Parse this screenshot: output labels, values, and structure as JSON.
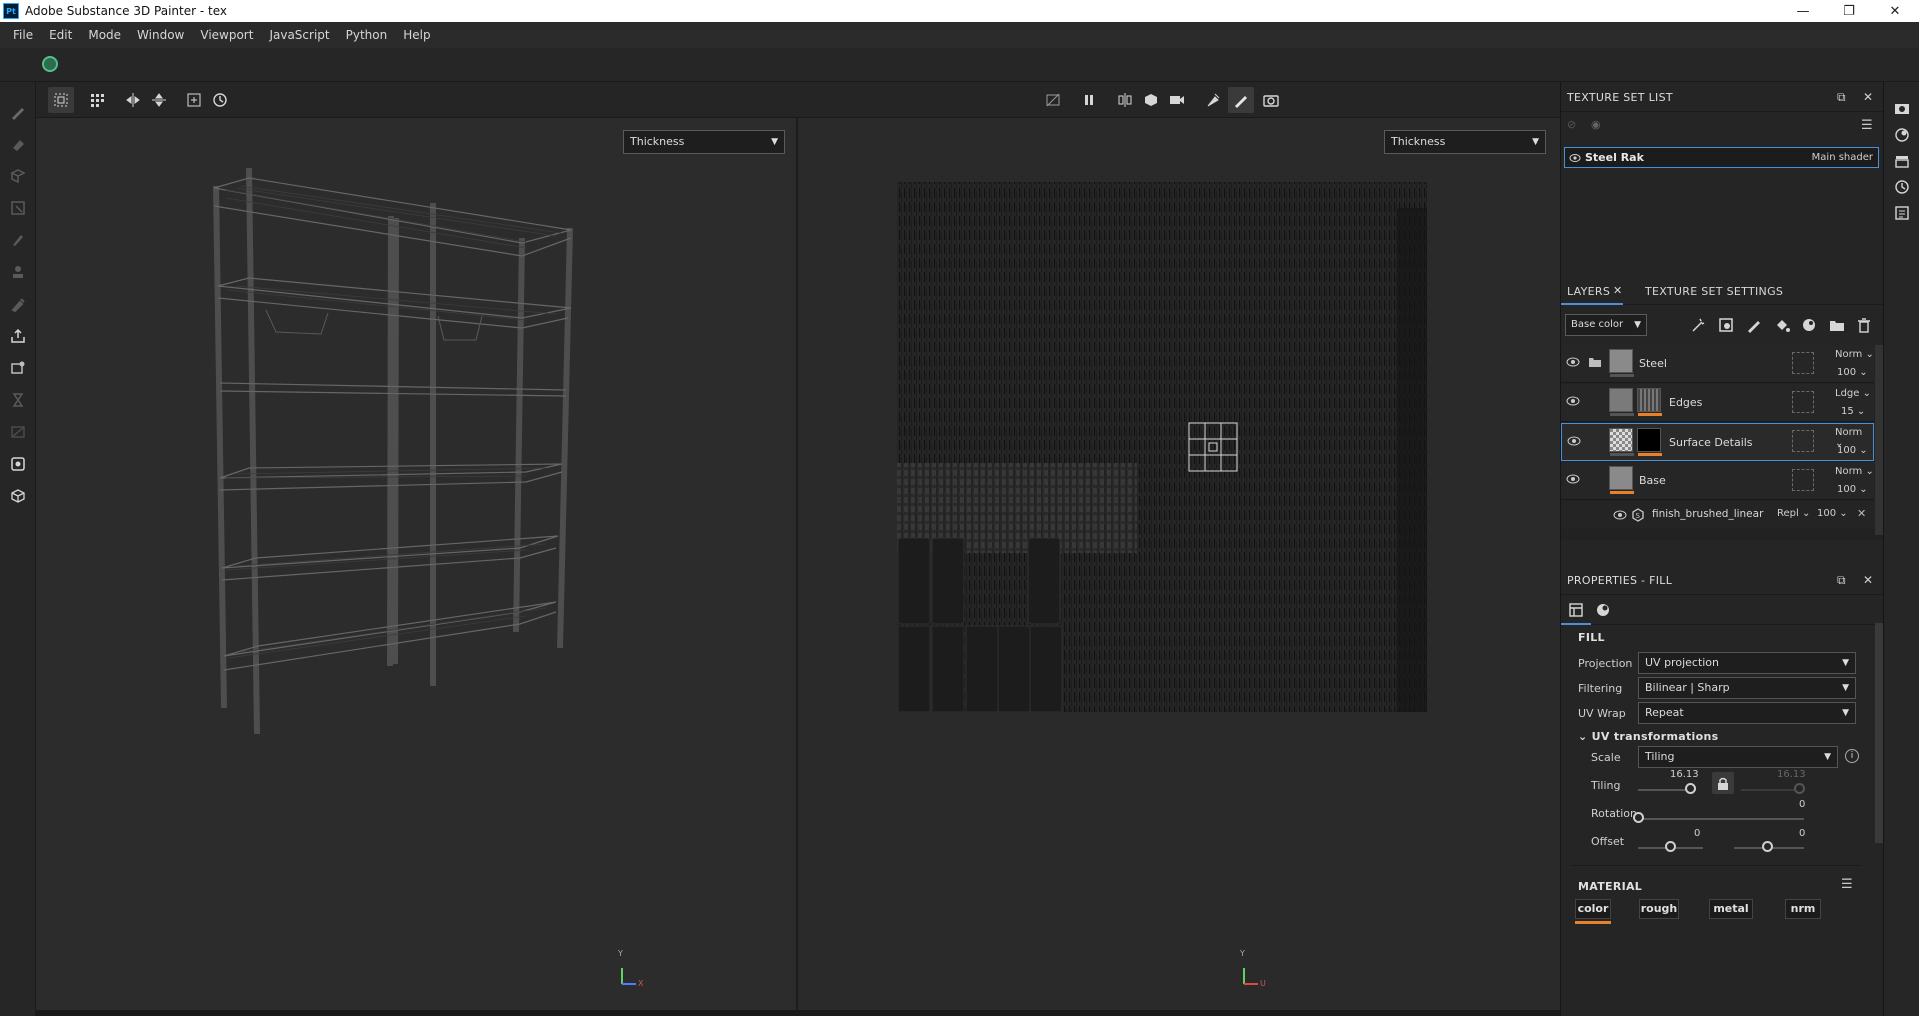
{
  "window": {
    "title": "Adobe Substance 3D Painter - tex",
    "logo": "Pt",
    "minimize": "—",
    "maximize": "❐",
    "close": "✕"
  },
  "menu": [
    "File",
    "Edit",
    "Mode",
    "Window",
    "Viewport",
    "JavaScript",
    "Python",
    "Help"
  ],
  "viewports": {
    "left": {
      "channel": "Thickness"
    },
    "right": {
      "channel": "Thickness"
    },
    "axis": {
      "y": "Y",
      "x": "X",
      "u": "U"
    }
  },
  "texture_set_list": {
    "title": "TEXTURE SET LIST",
    "item": {
      "name": "Steel Rak",
      "shader": "Main shader"
    }
  },
  "layers": {
    "tab_layers": "LAYERS",
    "tab_settings": "TEXTURE SET SETTINGS",
    "channel": "Base color",
    "items": [
      {
        "name": "Steel",
        "blend": "Norm",
        "opacity": "100"
      },
      {
        "name": "Edges",
        "blend": "Ldge",
        "opacity": "15"
      },
      {
        "name": "Surface Details",
        "blend": "Norm",
        "opacity": "100"
      },
      {
        "name": "Base",
        "blend": "Norm",
        "opacity": "100"
      }
    ],
    "sub": {
      "name": "finish_brushed_linear",
      "blend": "Repl",
      "opacity": "100"
    }
  },
  "properties": {
    "title": "PROPERTIES - FILL",
    "fill_title": "FILL",
    "projection": {
      "label": "Projection",
      "value": "UV projection"
    },
    "filtering": {
      "label": "Filtering",
      "value": "Bilinear | Sharp"
    },
    "uvwrap": {
      "label": "UV Wrap",
      "value": "Repeat"
    },
    "uvt_title": "UV transformations",
    "scale": {
      "label": "Scale",
      "value": "Tiling"
    },
    "tiling": {
      "label": "Tiling",
      "value": "16.13",
      "value2": "16.13",
      "fraction": 0.9
    },
    "rotation": {
      "label": "Rotation",
      "value": "0",
      "fraction": 0.0
    },
    "offset": {
      "label": "Offset",
      "value": "0",
      "value2": "0",
      "fraction": 0.5
    },
    "material_title": "MATERIAL",
    "material_buttons": [
      "color",
      "rough",
      "metal",
      "nrm"
    ]
  }
}
